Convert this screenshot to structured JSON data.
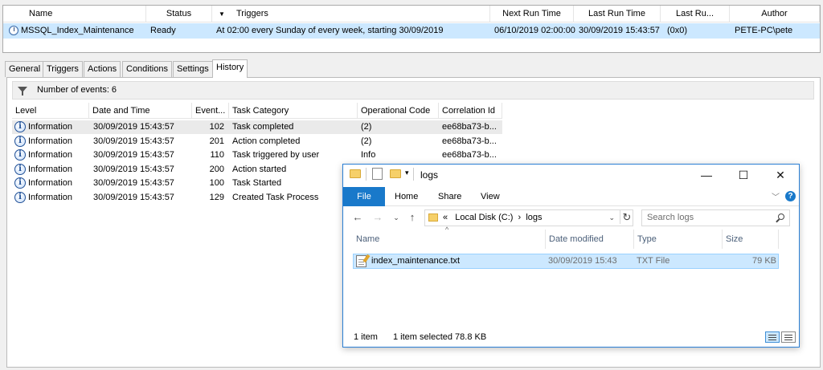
{
  "task_list": {
    "columns": [
      "Name",
      "Status",
      "Triggers",
      "Next Run Time",
      "Last Run Time",
      "Last Ru...",
      "Author"
    ],
    "rows": [
      {
        "name": "MSSQL_Index_Maintenance",
        "status": "Ready",
        "triggers": "At 02:00 every Sunday of every week, starting 30/09/2019",
        "next_run": "06/10/2019 02:00:00",
        "last_run": "30/09/2019 15:43:57",
        "last_result": "(0x0)",
        "author": "PETE-PC\\pete"
      }
    ]
  },
  "tabs": [
    "General",
    "Triggers",
    "Actions",
    "Conditions",
    "Settings",
    "History"
  ],
  "active_tab": "History",
  "history": {
    "events_label": "Number of events: 6",
    "columns": [
      "Level",
      "Date and Time",
      "Event...",
      "Task Category",
      "Operational Code",
      "Correlation Id"
    ],
    "rows": [
      {
        "level": "Information",
        "datetime": "30/09/2019 15:43:57",
        "event_id": "102",
        "category": "Task completed",
        "op_code": "(2)",
        "correlation": "ee68ba73-b..."
      },
      {
        "level": "Information",
        "datetime": "30/09/2019 15:43:57",
        "event_id": "201",
        "category": "Action completed",
        "op_code": "(2)",
        "correlation": "ee68ba73-b..."
      },
      {
        "level": "Information",
        "datetime": "30/09/2019 15:43:57",
        "event_id": "110",
        "category": "Task triggered by user",
        "op_code": "Info",
        "correlation": "ee68ba73-b..."
      },
      {
        "level": "Information",
        "datetime": "30/09/2019 15:43:57",
        "event_id": "200",
        "category": "Action started",
        "op_code": "",
        "correlation": ""
      },
      {
        "level": "Information",
        "datetime": "30/09/2019 15:43:57",
        "event_id": "100",
        "category": "Task Started",
        "op_code": "",
        "correlation": ""
      },
      {
        "level": "Information",
        "datetime": "30/09/2019 15:43:57",
        "event_id": "129",
        "category": "Created Task Process",
        "op_code": "",
        "correlation": ""
      }
    ]
  },
  "explorer": {
    "title": "logs",
    "ribbon_tabs": [
      "File",
      "Home",
      "Share",
      "View"
    ],
    "help_glyph": "?",
    "address": {
      "prefix": "«",
      "parts": [
        "Local Disk (C:)",
        "logs"
      ],
      "separator": "›"
    },
    "search_placeholder": "Search logs",
    "columns": [
      "Name",
      "Date modified",
      "Type",
      "Size"
    ],
    "files": [
      {
        "name": "index_maintenance.txt",
        "modified": "30/09/2019 15:43",
        "type": "TXT File",
        "size": "79 KB"
      }
    ],
    "status": {
      "count": "1 item",
      "selected": "1 item selected  78.8 KB"
    },
    "controls": {
      "minimize": "—",
      "maximize": "☐",
      "close": "✕"
    }
  }
}
